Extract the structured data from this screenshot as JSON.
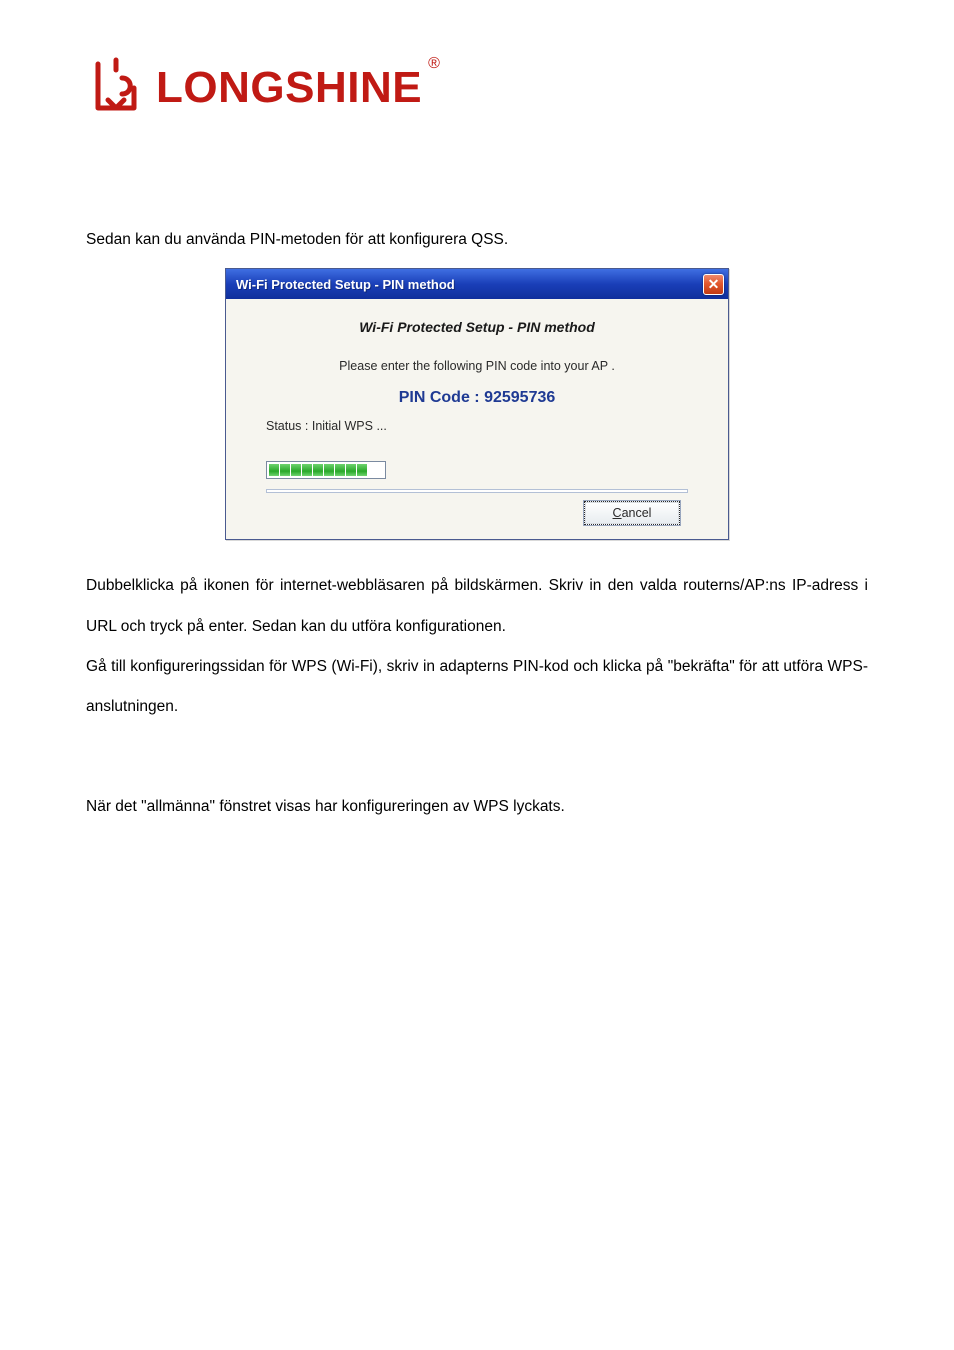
{
  "brand": {
    "name": "LONGSHINE",
    "reg": "®",
    "color": "#c01a14"
  },
  "text": {
    "intro": "Sedan kan du använda PIN-metoden för att konfigurera QSS.",
    "p2": "Dubbelklicka på ikonen för internet-webbläsaren på bildskärmen. Skriv in den valda routerns/AP:ns IP-adress i URL och tryck på enter. Sedan kan du utföra konfigurationen.",
    "p3": "Gå till konfigureringssidan för WPS (Wi-Fi), skriv in adapterns PIN-kod och klicka på \"bekräfta\" för att utföra WPS-anslutningen.",
    "p4": "När det \"allmänna\" fönstret visas har konfigureringen av WPS lyckats."
  },
  "dialog": {
    "title": "Wi-Fi Protected Setup - PIN method",
    "subtitle": "Wi-Fi Protected Setup - PIN method",
    "instruction": "Please enter the following PIN code into your AP .",
    "pin_label": "PIN Code :  ",
    "pin_value": "92595736",
    "status_label": "Status :  ",
    "status_value": "Initial WPS ...",
    "cancel_prefix": "C",
    "cancel_rest": "ancel",
    "progress_blocks": 9
  }
}
